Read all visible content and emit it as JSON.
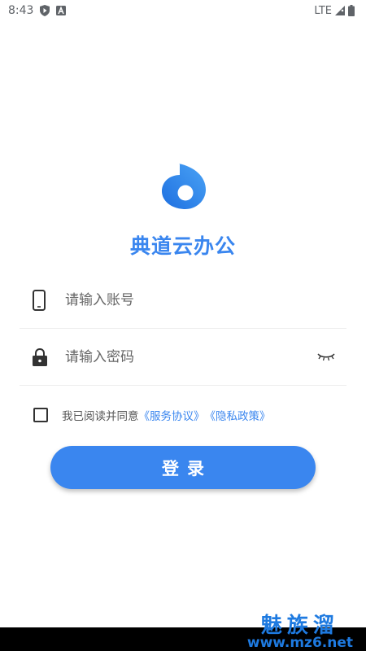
{
  "status_bar": {
    "time": "8:43",
    "network": "LTE",
    "icons": [
      "shield-notification-icon",
      "a-notification-icon",
      "signal-icon",
      "battery-icon"
    ]
  },
  "app": {
    "name": "典道云办公",
    "brand_color": "#3a86ef"
  },
  "form": {
    "account_placeholder": "请输入账号",
    "account_value": "",
    "password_placeholder": "请输入密码",
    "password_value": ""
  },
  "agreement": {
    "prefix": "我已阅读并同意",
    "service_link": "《服务协议》",
    "privacy_link": "《隐私政策》",
    "checked": false
  },
  "login_button": "登录",
  "watermark": {
    "top": "魅族溜",
    "bottom": "www.mz6.net"
  }
}
